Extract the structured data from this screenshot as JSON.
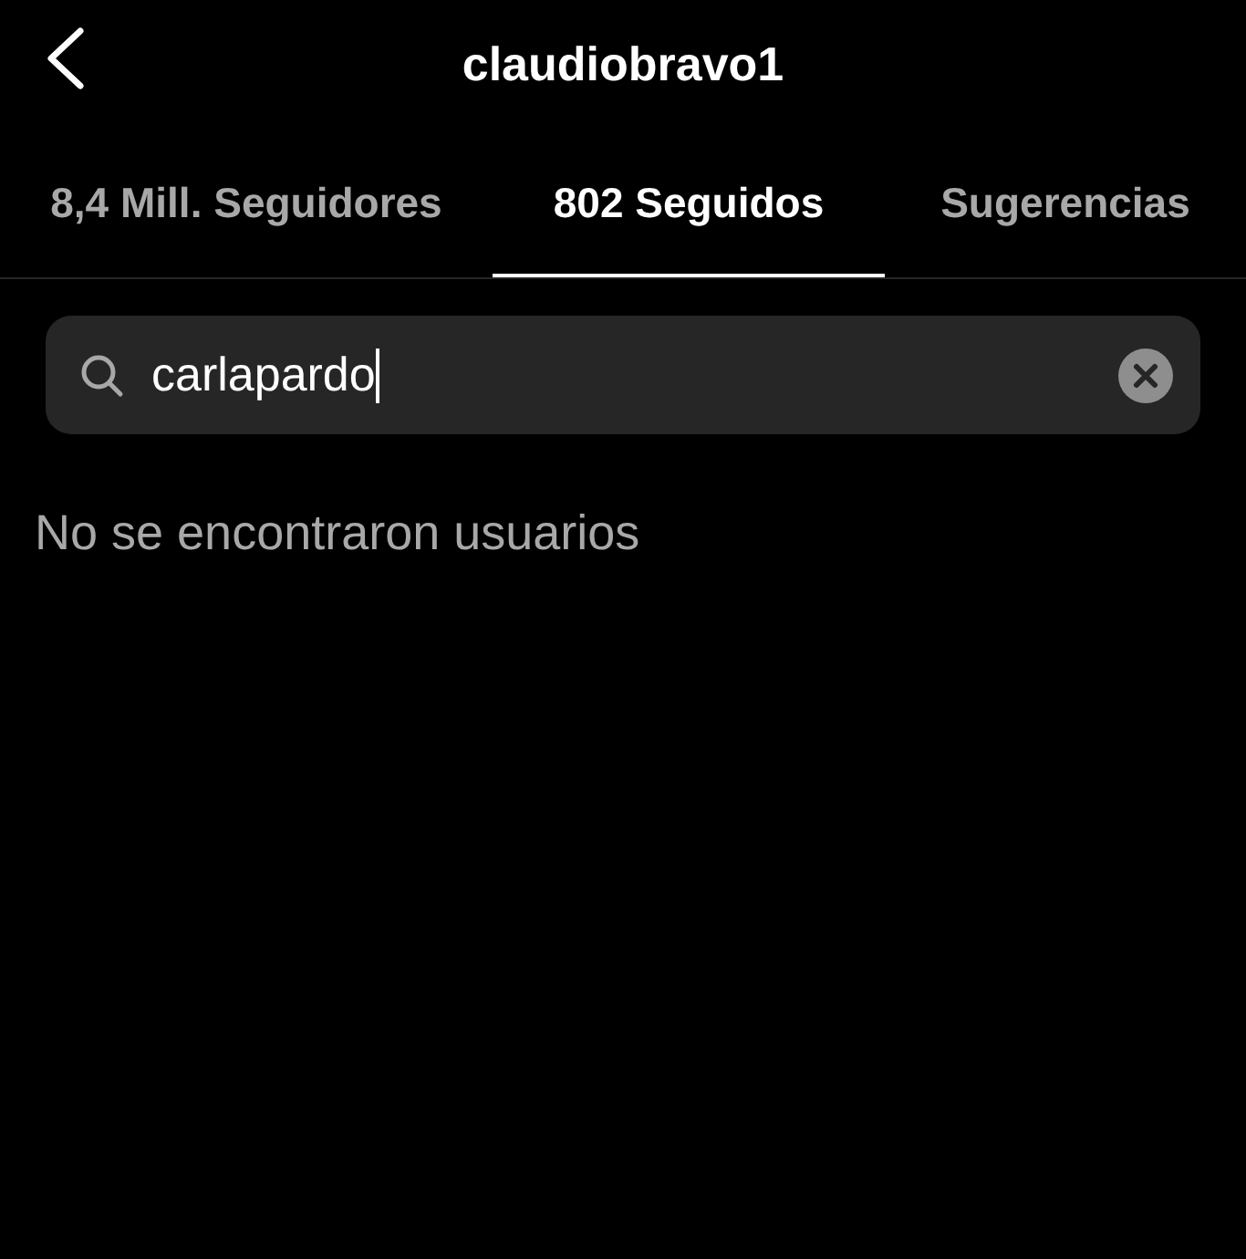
{
  "header": {
    "title": "claudiobravo1"
  },
  "tabs": [
    {
      "label": "8,4 Mill. Seguidores",
      "selected": false
    },
    {
      "label": "802 Seguidos",
      "selected": true
    },
    {
      "label": "Sugerencias",
      "selected": false
    }
  ],
  "search": {
    "value": "carlapardo",
    "focused": true
  },
  "message": "No se encontraron usuarios"
}
